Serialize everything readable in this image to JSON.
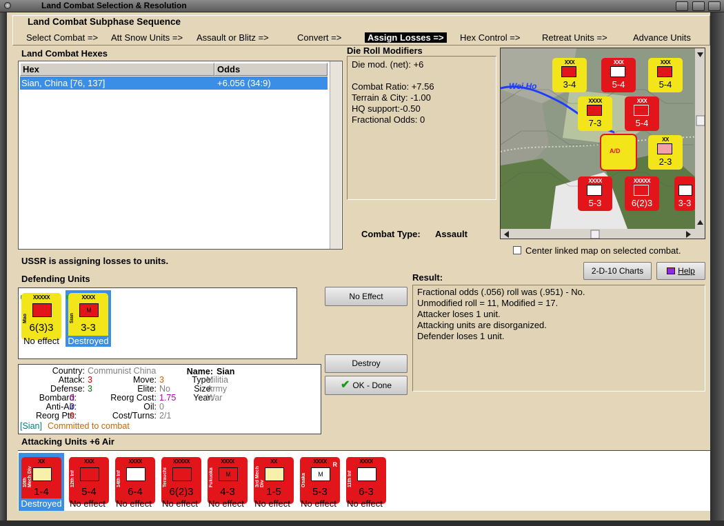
{
  "window": {
    "title": "Land Combat Selection & Resolution"
  },
  "sequence": {
    "title": "Land Combat Subphase Sequence",
    "steps": [
      "Select Combat =>",
      "Att Snow Units =>",
      "Assault or Blitz =>",
      "Convert =>",
      "Assign Losses =>",
      "Hex Control =>",
      "Retreat Units =>",
      "Advance Units"
    ],
    "active_index": 4
  },
  "hexes": {
    "title": "Land Combat Hexes",
    "columns": [
      "Hex",
      "Odds"
    ],
    "rows": [
      {
        "hex": "Sian, China [76, 137]",
        "odds": "+6.056 (34:9)"
      }
    ]
  },
  "modifiers": {
    "title": "Die Roll Modifiers",
    "lines": [
      "Die mod. (net): +6",
      "",
      "Combat Ratio: +7.56",
      "Terrain & City: -1.00",
      "HQ support:-0.50",
      "Fractional Odds: 0"
    ]
  },
  "combat_type": {
    "label": "Combat Type:",
    "value": "Assault"
  },
  "map": {
    "river_label": "Wei Ho",
    "map_units": [
      {
        "size": "XXX",
        "str": "3-4",
        "color": "yellow"
      },
      {
        "size": "XXX",
        "str": "5-4",
        "color": "red"
      },
      {
        "size": "XXX",
        "str": "5-4",
        "color": "yellow"
      },
      {
        "size": "XXXX",
        "str": "7-3",
        "color": "yellow"
      },
      {
        "size": "XXX",
        "str": "5-4",
        "color": "red"
      },
      {
        "size": "XX",
        "str": "2-3",
        "color": "yellow"
      },
      {
        "size": "XXXX",
        "str": "5-3",
        "color": "red"
      },
      {
        "size": "XXXXX",
        "str": "6(2)3",
        "color": "red"
      },
      {
        "size": "XXX",
        "str": "3-3",
        "color": "red"
      }
    ]
  },
  "center_map": {
    "label": "Center linked map on selected combat.",
    "checked": false
  },
  "status": "USSR is assigning losses to units.",
  "buttons": {
    "charts": "2-D-10 Charts",
    "help": "Help",
    "no_effect": "No Effect",
    "destroy": "Destroy",
    "ok": "OK - Done"
  },
  "defending": {
    "title": "Defending Units",
    "units": [
      {
        "name": "Mao",
        "size": "XXXXX",
        "str": "6(3)3",
        "status": "No effect",
        "color": "yellow",
        "selected": false,
        "mech": false
      },
      {
        "name": "Sian",
        "size": "XXXX",
        "str": "3-3",
        "status": "Destroyed",
        "color": "yellow",
        "selected": true,
        "mech": false
      }
    ]
  },
  "unit_info": {
    "country_label": "Country:",
    "country": "Communist China",
    "name_label": "Name:",
    "name": "Sian",
    "attack_label": "Attack:",
    "attack": "3",
    "move_label": "Move:",
    "move": "3",
    "type_label": "Type:",
    "type": "Militia",
    "defense_label": "Defense:",
    "defense": "3",
    "elite_label": "Elite:",
    "elite": "No",
    "size_label": "Size:",
    "size": "Army",
    "bombard_label": "Bombard:",
    "bombard": "0",
    "reorg_cost_label": "Reorg Cost:",
    "reorg_cost": "1.75",
    "year_label": "Year:",
    "year": "War",
    "antiair_label": "Anti-Air:",
    "antiair": "0",
    "oil_label": "Oil:",
    "oil": "0",
    "reorg_pts_label": "Reorg Pts:",
    "reorg_pts": "0",
    "cost_turns_label": "Cost/Turns:",
    "cost_turns": "2/1",
    "tag": "[Sian]",
    "commit": "Committed to combat"
  },
  "result": {
    "title": "Result:",
    "lines": [
      "Fractional odds (.056) roll was (.951)  - No.",
      "Unmodified roll = 11, Modified = 17.",
      "Attacker loses 1 unit.",
      "Attacking units are disorganized.",
      "Defender loses 1 unit."
    ]
  },
  "attacking": {
    "title": "Attacking Units +6 Air",
    "units": [
      {
        "name": "10th Mech Div",
        "size": "XX",
        "str": "1-4",
        "status": "Destroyed",
        "selected": true,
        "yellow": true
      },
      {
        "name": "12th Inf",
        "size": "XXX",
        "str": "5-4",
        "status": "No effect",
        "selected": false,
        "yellow": false
      },
      {
        "name": "14th Inf",
        "size": "XXXX",
        "str": "6-4",
        "status": "No effect",
        "selected": false,
        "yellow": false
      },
      {
        "name": "Terauchi",
        "size": "XXXXX",
        "str": "6(2)3",
        "status": "No effect",
        "selected": false,
        "yellow": false
      },
      {
        "name": "Fukuoka",
        "size": "XXXX",
        "str": "4-3",
        "status": "No effect",
        "selected": false,
        "yellow": false
      },
      {
        "name": "3rd Mech Div",
        "size": "XX",
        "str": "1-5",
        "status": "No effect",
        "selected": false,
        "yellow": true
      },
      {
        "name": "Osaka",
        "size": "XXXX",
        "str": "5-3",
        "status": "No effect",
        "selected": false,
        "yellow": false
      },
      {
        "name": "11th Inf",
        "size": "XXXX",
        "str": "6-3",
        "status": "No effect",
        "selected": false,
        "yellow": false
      }
    ]
  },
  "colors": {
    "panel_bg": "#e3d6b9",
    "selection": "#3a8ee6",
    "unit_red": "#e2161a",
    "unit_yellow": "#f2e61a",
    "value_red": "#cc0000",
    "value_green": "#008000",
    "value_magenta": "#b000b0",
    "value_blue": "#0000cc",
    "value_gray": "#808080",
    "value_orange": "#cc6600"
  }
}
